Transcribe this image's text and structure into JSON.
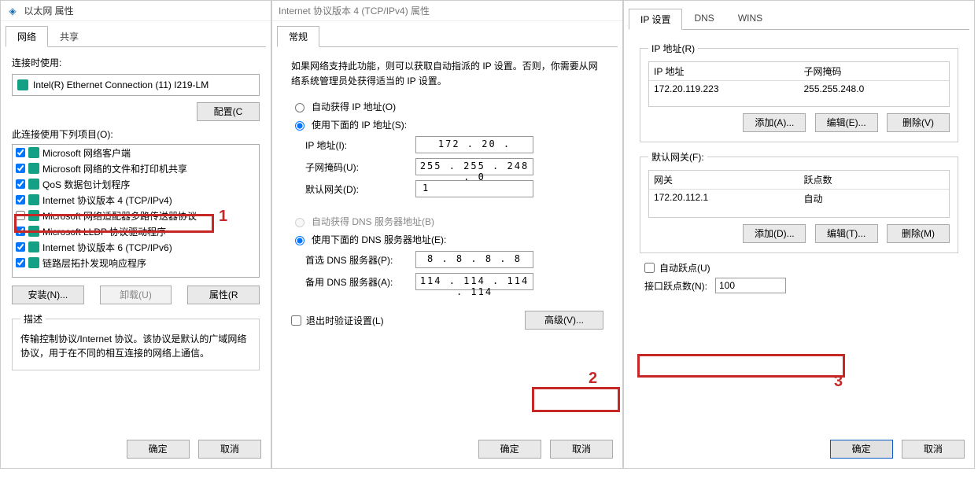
{
  "win1": {
    "title": "以太网 属性",
    "tabs": [
      "网络",
      "共享"
    ],
    "connect_using_label": "连接时使用:",
    "adapter_name": "Intel(R) Ethernet Connection (11) I219-LM",
    "configure_btn": "配置(C",
    "uses_items_label": "此连接使用下列项目(O):",
    "items": [
      "Microsoft 网络客户端",
      "Microsoft 网络的文件和打印机共享",
      "QoS 数据包计划程序",
      "Internet 协议版本 4 (TCP/IPv4)",
      "Microsoft 网络适配器多路传送器协议",
      "Microsoft LLDP 协议驱动程序",
      "Internet 协议版本 6 (TCP/IPv6)",
      "链路层拓扑发现响应程序"
    ],
    "install_btn": "安装(N)...",
    "uninstall_btn": "卸载(U)",
    "properties_btn": "属性(R",
    "desc_legend": "描述",
    "desc_text": "传输控制协议/Internet 协议。该协议是默认的广域网络协议，用于在不同的相互连接的网络上通信。",
    "ok": "确定",
    "cancel": "取消"
  },
  "win2": {
    "title": "Internet 协议版本 4 (TCP/IPv4) 属性",
    "tab": "常规",
    "intro": "如果网络支持此功能，则可以获取自动指派的 IP 设置。否则，你需要从网络系统管理员处获得适当的 IP 设置。",
    "auto_ip": "自动获得 IP 地址(O)",
    "use_ip": "使用下面的 IP 地址(S):",
    "ip_label": "IP 地址(I):",
    "ip_val": "172 . 20 .           ",
    "mask_label": "子网掩码(U):",
    "mask_val": "255 . 255 . 248 .  0",
    "gw_label": "默认网关(D):",
    "gw_val": "1          ",
    "auto_dns": "自动获得 DNS 服务器地址(B)",
    "use_dns": "使用下面的 DNS 服务器地址(E):",
    "dns1_label": "首选 DNS 服务器(P):",
    "dns1_val": "8  .  8  .  8  .  8",
    "dns2_label": "备用 DNS 服务器(A):",
    "dns2_val": "114 . 114 . 114 . 114",
    "validate": "退出时验证设置(L)",
    "advanced": "高级(V)...",
    "ok": "确定",
    "cancel": "取消"
  },
  "win3": {
    "tabs": [
      "IP 设置",
      "DNS",
      "WINS"
    ],
    "ip_group": "IP 地址(R)",
    "ip_h1": "IP 地址",
    "ip_h2": "子网掩码",
    "ip_r1c1": "172.20.119.223",
    "ip_r1c2": "255.255.248.0",
    "add": "添加(A)...",
    "edit": "编辑(E)...",
    "del": "删除(V)",
    "gw_group": "默认网关(F):",
    "gw_h1": "网关",
    "gw_h2": "跃点数",
    "gw_r1c1": "172.20.112.1",
    "gw_r1c2": "自动",
    "add2": "添加(D)...",
    "edit2": "编辑(T)...",
    "del2": "删除(M)",
    "auto_metric": "自动跃点(U)",
    "if_metric_label": "接口跃点数(N):",
    "if_metric_val": "100",
    "ok": "确定",
    "cancel": "取消"
  },
  "annot": {
    "a1": "1",
    "a2": "2",
    "a3": "3"
  }
}
